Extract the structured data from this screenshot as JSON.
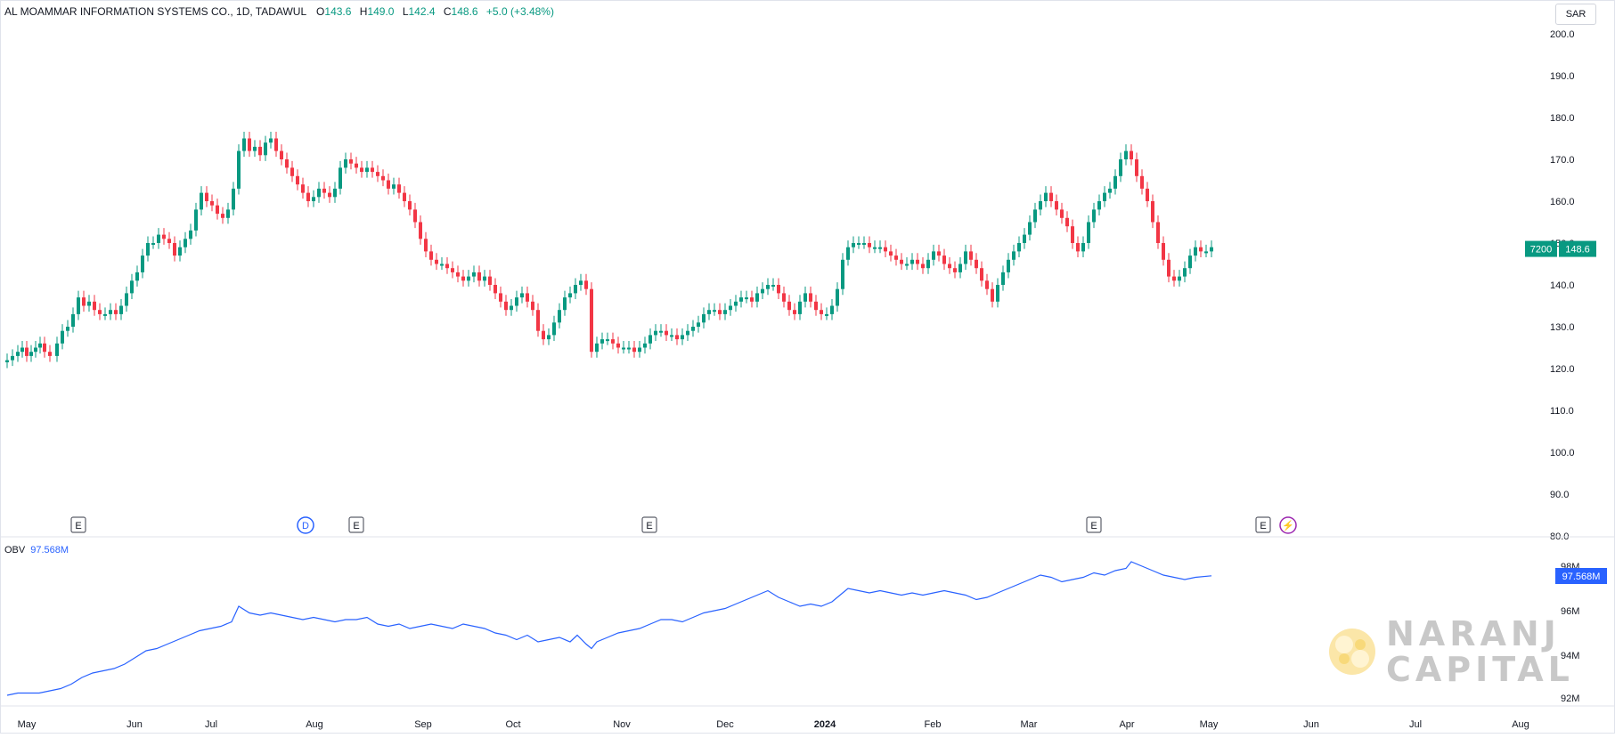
{
  "header": {
    "symbol_line": "AL MOAMMAR INFORMATION SYSTEMS CO., 1D, TADAWUL",
    "open_label": "O",
    "open": "143.6",
    "high_label": "H",
    "high": "149.0",
    "low_label": "L",
    "low": "142.4",
    "close_label": "C",
    "close": "148.6",
    "change": "+5.0 (+3.48%)"
  },
  "currency": "SAR",
  "price_badges": {
    "volume": "7200",
    "last": "148.6"
  },
  "indicator": {
    "name": "OBV",
    "value": "97.568M",
    "badge": "97.568M"
  },
  "watermark": {
    "line1": "NARANJ",
    "line2": "CAPITAL"
  },
  "colors": {
    "up": "#089981",
    "down": "#f23645",
    "obv": "#2962ff",
    "badge_green": "#089981",
    "badge_blue": "#2962ff"
  },
  "chart_data": {
    "type": "candlestick",
    "price_axis": {
      "ticks": [
        "200.0",
        "190.0",
        "180.0",
        "170.0",
        "160.0",
        "150.0",
        "140.0",
        "130.0",
        "120.0",
        "110.0",
        "100.0",
        "90.0",
        "80.0"
      ],
      "ylim": [
        80,
        200
      ]
    },
    "obv_axis": {
      "ticks": [
        "98M",
        "96M",
        "94M",
        "92M"
      ],
      "ylim": [
        91.5,
        98.6
      ],
      "unit": "M"
    },
    "time_axis": {
      "labels": [
        "May",
        "Jun",
        "Jul",
        "Aug",
        "Sep",
        "Oct",
        "Nov",
        "Dec",
        "2024",
        "Feb",
        "Mar",
        "Apr",
        "May",
        "Jun",
        "Jul",
        "Aug"
      ]
    },
    "events": [
      {
        "label": "E",
        "type": "earnings",
        "month": "May 2023"
      },
      {
        "label": "D",
        "type": "dividend",
        "month": "Aug 2023"
      },
      {
        "label": "E",
        "type": "earnings",
        "month": "Aug 2023"
      },
      {
        "label": "E",
        "type": "earnings",
        "month": "Nov 2023"
      },
      {
        "label": "E",
        "type": "earnings",
        "month": "Mar 2024"
      },
      {
        "label": "E",
        "type": "earnings",
        "month": "May 2024"
      },
      {
        "label": "⚡",
        "type": "split",
        "month": "May 2024"
      }
    ],
    "price_series": [
      [
        0,
        122
      ],
      [
        6,
        123
      ],
      [
        12,
        124
      ],
      [
        17,
        125
      ],
      [
        22,
        123
      ],
      [
        27,
        124
      ],
      [
        32,
        125
      ],
      [
        37,
        126
      ],
      [
        42,
        124
      ],
      [
        48,
        123
      ],
      [
        56,
        126
      ],
      [
        62,
        129
      ],
      [
        68,
        130
      ],
      [
        74,
        133
      ],
      [
        80,
        137
      ],
      [
        86,
        135
      ],
      [
        92,
        136
      ],
      [
        98,
        134
      ],
      [
        104,
        133
      ],
      [
        110,
        133
      ],
      [
        116,
        134
      ],
      [
        122,
        133
      ],
      [
        128,
        135
      ],
      [
        134,
        138
      ],
      [
        140,
        141
      ],
      [
        146,
        143
      ],
      [
        152,
        147
      ],
      [
        158,
        150
      ],
      [
        164,
        150
      ],
      [
        170,
        152
      ],
      [
        176,
        151
      ],
      [
        182,
        150
      ],
      [
        188,
        147
      ],
      [
        194,
        149
      ],
      [
        200,
        151
      ],
      [
        206,
        153
      ],
      [
        212,
        158
      ],
      [
        218,
        162
      ],
      [
        224,
        160
      ],
      [
        230,
        159
      ],
      [
        236,
        157
      ],
      [
        242,
        156
      ],
      [
        248,
        158
      ],
      [
        254,
        163
      ],
      [
        260,
        172
      ],
      [
        266,
        175
      ],
      [
        272,
        172
      ],
      [
        278,
        173
      ],
      [
        284,
        171
      ],
      [
        290,
        174
      ],
      [
        296,
        175
      ],
      [
        302,
        172
      ],
      [
        308,
        170
      ],
      [
        314,
        168
      ],
      [
        320,
        166
      ],
      [
        326,
        164
      ],
      [
        332,
        162
      ],
      [
        338,
        160
      ],
      [
        344,
        161
      ],
      [
        350,
        163
      ],
      [
        356,
        162
      ],
      [
        362,
        161
      ],
      [
        368,
        163
      ],
      [
        374,
        168
      ],
      [
        380,
        170
      ],
      [
        386,
        169
      ],
      [
        392,
        168
      ],
      [
        398,
        167
      ],
      [
        404,
        168
      ],
      [
        410,
        167
      ],
      [
        416,
        166
      ],
      [
        422,
        165
      ],
      [
        428,
        163
      ],
      [
        434,
        164
      ],
      [
        440,
        162
      ],
      [
        446,
        160
      ],
      [
        452,
        158
      ],
      [
        458,
        155
      ],
      [
        464,
        151
      ],
      [
        470,
        148
      ],
      [
        476,
        146
      ],
      [
        482,
        145
      ],
      [
        488,
        145
      ],
      [
        494,
        144
      ],
      [
        500,
        143
      ],
      [
        506,
        142
      ],
      [
        512,
        141
      ],
      [
        518,
        142
      ],
      [
        524,
        143
      ],
      [
        530,
        141
      ],
      [
        536,
        142
      ],
      [
        542,
        140
      ],
      [
        548,
        138
      ],
      [
        554,
        136
      ],
      [
        560,
        134
      ],
      [
        566,
        135
      ],
      [
        572,
        137
      ],
      [
        578,
        138
      ],
      [
        584,
        136
      ],
      [
        590,
        134
      ],
      [
        596,
        129
      ],
      [
        602,
        127
      ],
      [
        608,
        128
      ],
      [
        614,
        131
      ],
      [
        620,
        134
      ],
      [
        626,
        137
      ],
      [
        632,
        138
      ],
      [
        638,
        140
      ],
      [
        644,
        141
      ],
      [
        650,
        139
      ],
      [
        656,
        124
      ],
      [
        662,
        126
      ],
      [
        668,
        127
      ],
      [
        674,
        127
      ],
      [
        680,
        126
      ],
      [
        686,
        125
      ],
      [
        692,
        125
      ],
      [
        698,
        125
      ],
      [
        704,
        124
      ],
      [
        710,
        125
      ],
      [
        716,
        126
      ],
      [
        722,
        128
      ],
      [
        728,
        129
      ],
      [
        734,
        129
      ],
      [
        740,
        128
      ],
      [
        746,
        128
      ],
      [
        752,
        127
      ],
      [
        758,
        128
      ],
      [
        764,
        129
      ],
      [
        770,
        130
      ],
      [
        776,
        131
      ],
      [
        782,
        133
      ],
      [
        788,
        134
      ],
      [
        794,
        134
      ],
      [
        800,
        133
      ],
      [
        806,
        134
      ],
      [
        812,
        135
      ],
      [
        818,
        136
      ],
      [
        824,
        137
      ],
      [
        830,
        137
      ],
      [
        836,
        136
      ],
      [
        842,
        138
      ],
      [
        848,
        139
      ],
      [
        854,
        140
      ],
      [
        860,
        140
      ],
      [
        866,
        138
      ],
      [
        872,
        136
      ],
      [
        878,
        134
      ],
      [
        884,
        133
      ],
      [
        890,
        136
      ],
      [
        896,
        138
      ],
      [
        902,
        136
      ],
      [
        908,
        134
      ],
      [
        914,
        133
      ],
      [
        920,
        133
      ],
      [
        926,
        135
      ],
      [
        932,
        139
      ],
      [
        938,
        146
      ],
      [
        944,
        149
      ],
      [
        950,
        150
      ],
      [
        956,
        150
      ],
      [
        962,
        150
      ],
      [
        968,
        149
      ],
      [
        974,
        149
      ],
      [
        980,
        149
      ],
      [
        986,
        148
      ],
      [
        992,
        147
      ],
      [
        998,
        146
      ],
      [
        1004,
        145
      ],
      [
        1010,
        145
      ],
      [
        1016,
        146
      ],
      [
        1022,
        145
      ],
      [
        1028,
        144
      ],
      [
        1034,
        146
      ],
      [
        1040,
        148
      ],
      [
        1046,
        147
      ],
      [
        1052,
        145
      ],
      [
        1058,
        144
      ],
      [
        1064,
        143
      ],
      [
        1070,
        145
      ],
      [
        1076,
        148
      ],
      [
        1082,
        146
      ],
      [
        1088,
        144
      ],
      [
        1094,
        141
      ],
      [
        1100,
        139
      ],
      [
        1106,
        136
      ],
      [
        1112,
        140
      ],
      [
        1118,
        143
      ],
      [
        1124,
        146
      ],
      [
        1130,
        148
      ],
      [
        1136,
        150
      ],
      [
        1142,
        152
      ],
      [
        1148,
        155
      ],
      [
        1154,
        158
      ],
      [
        1160,
        160
      ],
      [
        1166,
        162
      ],
      [
        1172,
        160
      ],
      [
        1178,
        158
      ],
      [
        1184,
        156
      ],
      [
        1190,
        154
      ],
      [
        1196,
        150
      ],
      [
        1202,
        148
      ],
      [
        1208,
        150
      ],
      [
        1214,
        155
      ],
      [
        1220,
        158
      ],
      [
        1226,
        160
      ],
      [
        1232,
        162
      ],
      [
        1238,
        163
      ],
      [
        1244,
        166
      ],
      [
        1250,
        170
      ],
      [
        1256,
        172
      ],
      [
        1262,
        170
      ],
      [
        1268,
        166
      ],
      [
        1274,
        163
      ],
      [
        1280,
        160
      ],
      [
        1286,
        155
      ],
      [
        1292,
        150
      ],
      [
        1298,
        146
      ],
      [
        1304,
        142
      ],
      [
        1310,
        141
      ],
      [
        1316,
        142
      ],
      [
        1322,
        144
      ],
      [
        1328,
        147
      ],
      [
        1334,
        149
      ],
      [
        1340,
        148
      ],
      [
        1346,
        148
      ],
      [
        1352,
        149
      ]
    ],
    "obv_series": [
      [
        0,
        92.2
      ],
      [
        12,
        92.3
      ],
      [
        24,
        92.3
      ],
      [
        36,
        92.3
      ],
      [
        48,
        92.4
      ],
      [
        60,
        92.5
      ],
      [
        72,
        92.7
      ],
      [
        84,
        93.0
      ],
      [
        96,
        93.2
      ],
      [
        108,
        93.3
      ],
      [
        120,
        93.4
      ],
      [
        132,
        93.6
      ],
      [
        144,
        93.9
      ],
      [
        156,
        94.2
      ],
      [
        168,
        94.3
      ],
      [
        180,
        94.5
      ],
      [
        192,
        94.7
      ],
      [
        204,
        94.9
      ],
      [
        216,
        95.1
      ],
      [
        228,
        95.2
      ],
      [
        240,
        95.3
      ],
      [
        252,
        95.5
      ],
      [
        260,
        96.2
      ],
      [
        272,
        95.9
      ],
      [
        284,
        95.8
      ],
      [
        296,
        95.9
      ],
      [
        308,
        95.8
      ],
      [
        320,
        95.7
      ],
      [
        332,
        95.6
      ],
      [
        344,
        95.7
      ],
      [
        356,
        95.6
      ],
      [
        368,
        95.5
      ],
      [
        380,
        95.6
      ],
      [
        392,
        95.6
      ],
      [
        404,
        95.7
      ],
      [
        416,
        95.4
      ],
      [
        428,
        95.3
      ],
      [
        440,
        95.4
      ],
      [
        452,
        95.2
      ],
      [
        464,
        95.3
      ],
      [
        476,
        95.4
      ],
      [
        488,
        95.3
      ],
      [
        500,
        95.2
      ],
      [
        512,
        95.4
      ],
      [
        524,
        95.3
      ],
      [
        536,
        95.2
      ],
      [
        548,
        95.0
      ],
      [
        560,
        94.9
      ],
      [
        572,
        94.7
      ],
      [
        584,
        94.9
      ],
      [
        596,
        94.6
      ],
      [
        608,
        94.7
      ],
      [
        620,
        94.8
      ],
      [
        632,
        94.6
      ],
      [
        640,
        94.9
      ],
      [
        650,
        94.5
      ],
      [
        656,
        94.3
      ],
      [
        662,
        94.6
      ],
      [
        674,
        94.8
      ],
      [
        686,
        95.0
      ],
      [
        698,
        95.1
      ],
      [
        710,
        95.2
      ],
      [
        722,
        95.4
      ],
      [
        734,
        95.6
      ],
      [
        746,
        95.6
      ],
      [
        758,
        95.5
      ],
      [
        770,
        95.7
      ],
      [
        782,
        95.9
      ],
      [
        794,
        96.0
      ],
      [
        806,
        96.1
      ],
      [
        818,
        96.3
      ],
      [
        830,
        96.5
      ],
      [
        842,
        96.7
      ],
      [
        854,
        96.9
      ],
      [
        866,
        96.6
      ],
      [
        878,
        96.4
      ],
      [
        890,
        96.2
      ],
      [
        902,
        96.3
      ],
      [
        914,
        96.2
      ],
      [
        926,
        96.4
      ],
      [
        938,
        96.8
      ],
      [
        944,
        97.0
      ],
      [
        956,
        96.9
      ],
      [
        968,
        96.8
      ],
      [
        980,
        96.9
      ],
      [
        992,
        96.8
      ],
      [
        1004,
        96.7
      ],
      [
        1016,
        96.8
      ],
      [
        1028,
        96.7
      ],
      [
        1040,
        96.8
      ],
      [
        1052,
        96.9
      ],
      [
        1064,
        96.8
      ],
      [
        1076,
        96.7
      ],
      [
        1088,
        96.5
      ],
      [
        1100,
        96.6
      ],
      [
        1112,
        96.8
      ],
      [
        1124,
        97.0
      ],
      [
        1136,
        97.2
      ],
      [
        1148,
        97.4
      ],
      [
        1160,
        97.6
      ],
      [
        1172,
        97.5
      ],
      [
        1184,
        97.3
      ],
      [
        1196,
        97.4
      ],
      [
        1208,
        97.5
      ],
      [
        1220,
        97.7
      ],
      [
        1232,
        97.6
      ],
      [
        1244,
        97.8
      ],
      [
        1256,
        97.9
      ],
      [
        1262,
        98.2
      ],
      [
        1274,
        98.0
      ],
      [
        1286,
        97.8
      ],
      [
        1298,
        97.6
      ],
      [
        1310,
        97.5
      ],
      [
        1322,
        97.4
      ],
      [
        1334,
        97.5
      ],
      [
        1352,
        97.57
      ]
    ]
  }
}
